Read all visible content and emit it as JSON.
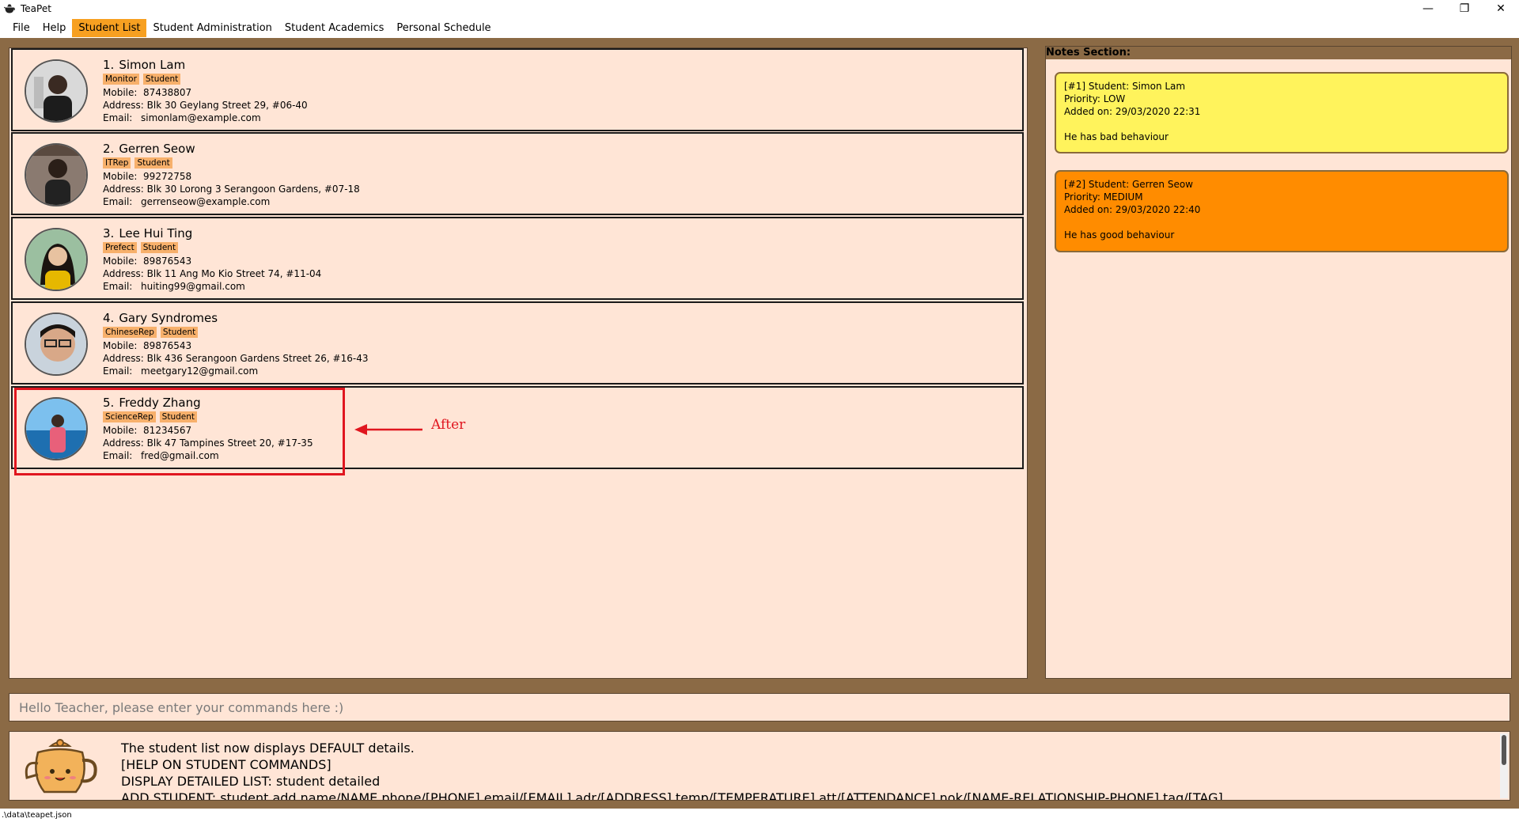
{
  "window": {
    "title": "TeaPet",
    "controls": {
      "minimize": "—",
      "restore": "❐",
      "close": "✕"
    }
  },
  "menu": [
    "File",
    "Help",
    "Student List",
    "Student Administration",
    "Student Academics",
    "Personal Schedule"
  ],
  "menu_active": "Student List",
  "students": [
    {
      "index": "1.",
      "name": "Simon Lam",
      "tags": [
        "Monitor",
        "Student"
      ],
      "mobile_label": "Mobile:",
      "mobile": "87438807",
      "address_label": "Address:",
      "address": "Blk 30 Geylang Street 29, #06-40",
      "email_label": "Email:",
      "email": "simonlam@example.com"
    },
    {
      "index": "2.",
      "name": "Gerren Seow",
      "tags": [
        "ITRep",
        "Student"
      ],
      "mobile_label": "Mobile:",
      "mobile": "99272758",
      "address_label": "Address:",
      "address": "Blk 30 Lorong 3 Serangoon Gardens, #07-18",
      "email_label": "Email:",
      "email": "gerrenseow@example.com"
    },
    {
      "index": "3.",
      "name": "Lee Hui Ting",
      "tags": [
        "Prefect",
        "Student"
      ],
      "mobile_label": "Mobile:",
      "mobile": "89876543",
      "address_label": "Address:",
      "address": "Blk 11 Ang Mo Kio Street 74, #11-04",
      "email_label": "Email:",
      "email": "huiting99@gmail.com"
    },
    {
      "index": "4.",
      "name": "Gary Syndromes",
      "tags": [
        "ChineseRep",
        "Student"
      ],
      "mobile_label": "Mobile:",
      "mobile": "89876543",
      "address_label": "Address:",
      "address": "Blk 436 Serangoon Gardens Street 26, #16-43",
      "email_label": "Email:",
      "email": "meetgary12@gmail.com"
    },
    {
      "index": "5.",
      "name": "Freddy Zhang",
      "tags": [
        "ScienceRep",
        "Student"
      ],
      "mobile_label": "Mobile:",
      "mobile": "81234567",
      "address_label": "Address:",
      "address": "Blk 47 Tampines Street 20, #17-35",
      "email_label": "Email:",
      "email": "fred@gmail.com"
    }
  ],
  "annotation": {
    "label": "After",
    "color": "#e0161f"
  },
  "notes": {
    "title": "Notes Section:",
    "items": [
      {
        "header": "[#1] Student: Simon Lam",
        "priority": "Priority: LOW",
        "added": "Added on: 29/03/2020 22:31",
        "content": "He has bad behaviour",
        "color": "#fff35c"
      },
      {
        "header": "[#2] Student: Gerren Seow",
        "priority": "Priority: MEDIUM",
        "added": "Added on: 29/03/2020 22:40",
        "content": "He has good behaviour",
        "color": "#ff8c00"
      }
    ]
  },
  "command": {
    "placeholder": "Hello Teacher, please enter your commands here :)",
    "value": ""
  },
  "result": {
    "lines": [
      "The student list now displays DEFAULT details.",
      "[HELP ON STUDENT COMMANDS]",
      "DISPLAY DETAILED LIST: student detailed",
      "ADD STUDENT: student add name/NAME phone/[PHONE] email/[EMAIL] adr/[ADDRESS] temp/[TEMPERATURE] att/[ATTENDANCE] nok/[NAME-RELATIONSHIP-PHONE] tag/[TAG]"
    ]
  },
  "status": {
    "path": ".\\data\\teapet.json"
  },
  "colors": {
    "frame": "#8b6a45",
    "panel": "#ffe5d6",
    "menu_active": "#f7a021",
    "tag": "#f7b06b"
  }
}
